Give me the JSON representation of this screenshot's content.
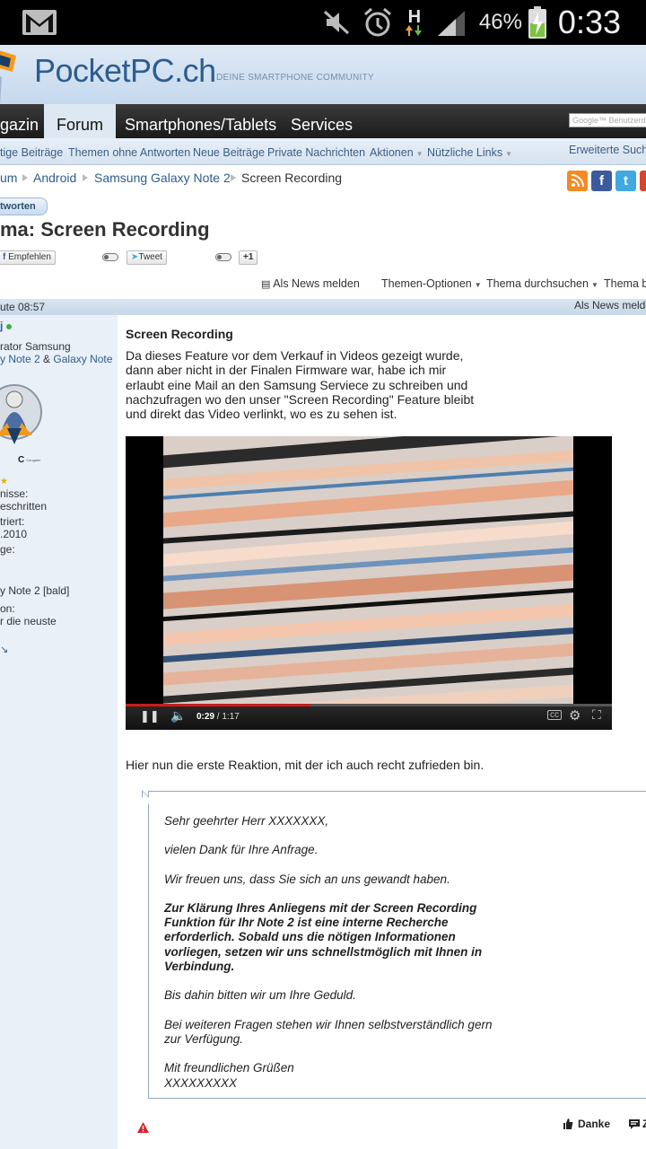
{
  "status_bar": {
    "network": "H",
    "battery": "46%",
    "clock": "0:33"
  },
  "header": {
    "site_name": "PocketPC.ch",
    "tagline": "DEINE SMARTPHONE COMMUNITY"
  },
  "navbar": {
    "tabs": [
      "gazin",
      "Forum",
      "Smartphones/Tablets",
      "Services"
    ],
    "search_placeholder": "Google™ Benutzerdef"
  },
  "subnav": {
    "links": [
      "tige Beiträge",
      "Themen ohne Antworten",
      "Neue Beiträge",
      "Private Nachrichten",
      "Aktionen",
      "Nützliche Links"
    ],
    "right_link": "Erweiterte Suche"
  },
  "breadcrumb": [
    "um",
    "Android",
    "Samsung Galaxy Note 2",
    "Screen Recording"
  ],
  "reply_button": "tworten",
  "thread_title": "ma: Screen Recording",
  "share": {
    "facebook": "Empfehlen",
    "tweet": "Tweet",
    "gplus": "+1"
  },
  "thread_options": {
    "news": "Als News melden",
    "themen_optionen": "Themen-Optionen",
    "durchsuchen": "Thema durchsuchen",
    "thema_b": "Thema b"
  },
  "post_bar": {
    "time": "ute 08:57",
    "news": "Als News melde"
  },
  "user_sidebar": {
    "name": "j",
    "role": "rator Samsung",
    "role_links_1": "y Note 2",
    "role_amp": "&",
    "role_links_2": "Galaxy Note",
    "badge_text": "Cengaler",
    "line1": "nisse:",
    "line2": "eschritten",
    "line3": "triert:",
    "line4": ".2010",
    "line5": "ge:",
    "line6": "y Note 2 [bald]",
    "line7": "on:",
    "line8": "r die neuste"
  },
  "post": {
    "title": "Screen Recording",
    "intro": "Da dieses Feature vor dem Verkauf in Videos gezeigt wurde, dann aber nicht in der Finalen Firmware war, habe ich mir erlaubt eine Mail an den Samsung Serviece zu schreiben und nachzufragen wo den unser \"Screen Recording\" Feature bleibt und direkt das Video verlinkt, wo es zu sehen ist.",
    "video": {
      "time_current": "0:29",
      "time_sep": " / ",
      "time_total": "1:17",
      "progress": 0.38
    },
    "reaction": "Hier nun die erste Reaktion, mit der ich auch recht zufrieden bin.",
    "quote": {
      "greeting": "Sehr geehrter Herr XXXXXXX,",
      "p1": "vielen Dank für Ihre Anfrage.",
      "p2": "Wir freuen uns, dass Sie sich an uns gewandt haben.",
      "p3": "Zur Klärung Ihres Anliegens mit der Screen Recording Funktion für Ihr Note 2 ist eine interne Recherche erforderlich. Sobald uns die nötigen Informationen vorliegen, setzen wir uns schnellstmöglich mit Ihnen in Verbindung.",
      "p4": "Bis dahin bitten wir um Ihre Geduld.",
      "p5": "Bei weiteren Fragen stehen wir Ihnen selbstverständlich gern zur Verfügung.",
      "closing": "Mit freundlichen Grüßen",
      "signature": "XXXXXXXXX"
    },
    "footer": {
      "danke": "Danke",
      "zitat": "Z"
    }
  },
  "colors": {
    "brand_blue": "#2d5d8e",
    "nav_dark": "#1b1b1b",
    "sidebar_bg": "#e9f0f8",
    "youtube_red": "#cc1b1b"
  }
}
